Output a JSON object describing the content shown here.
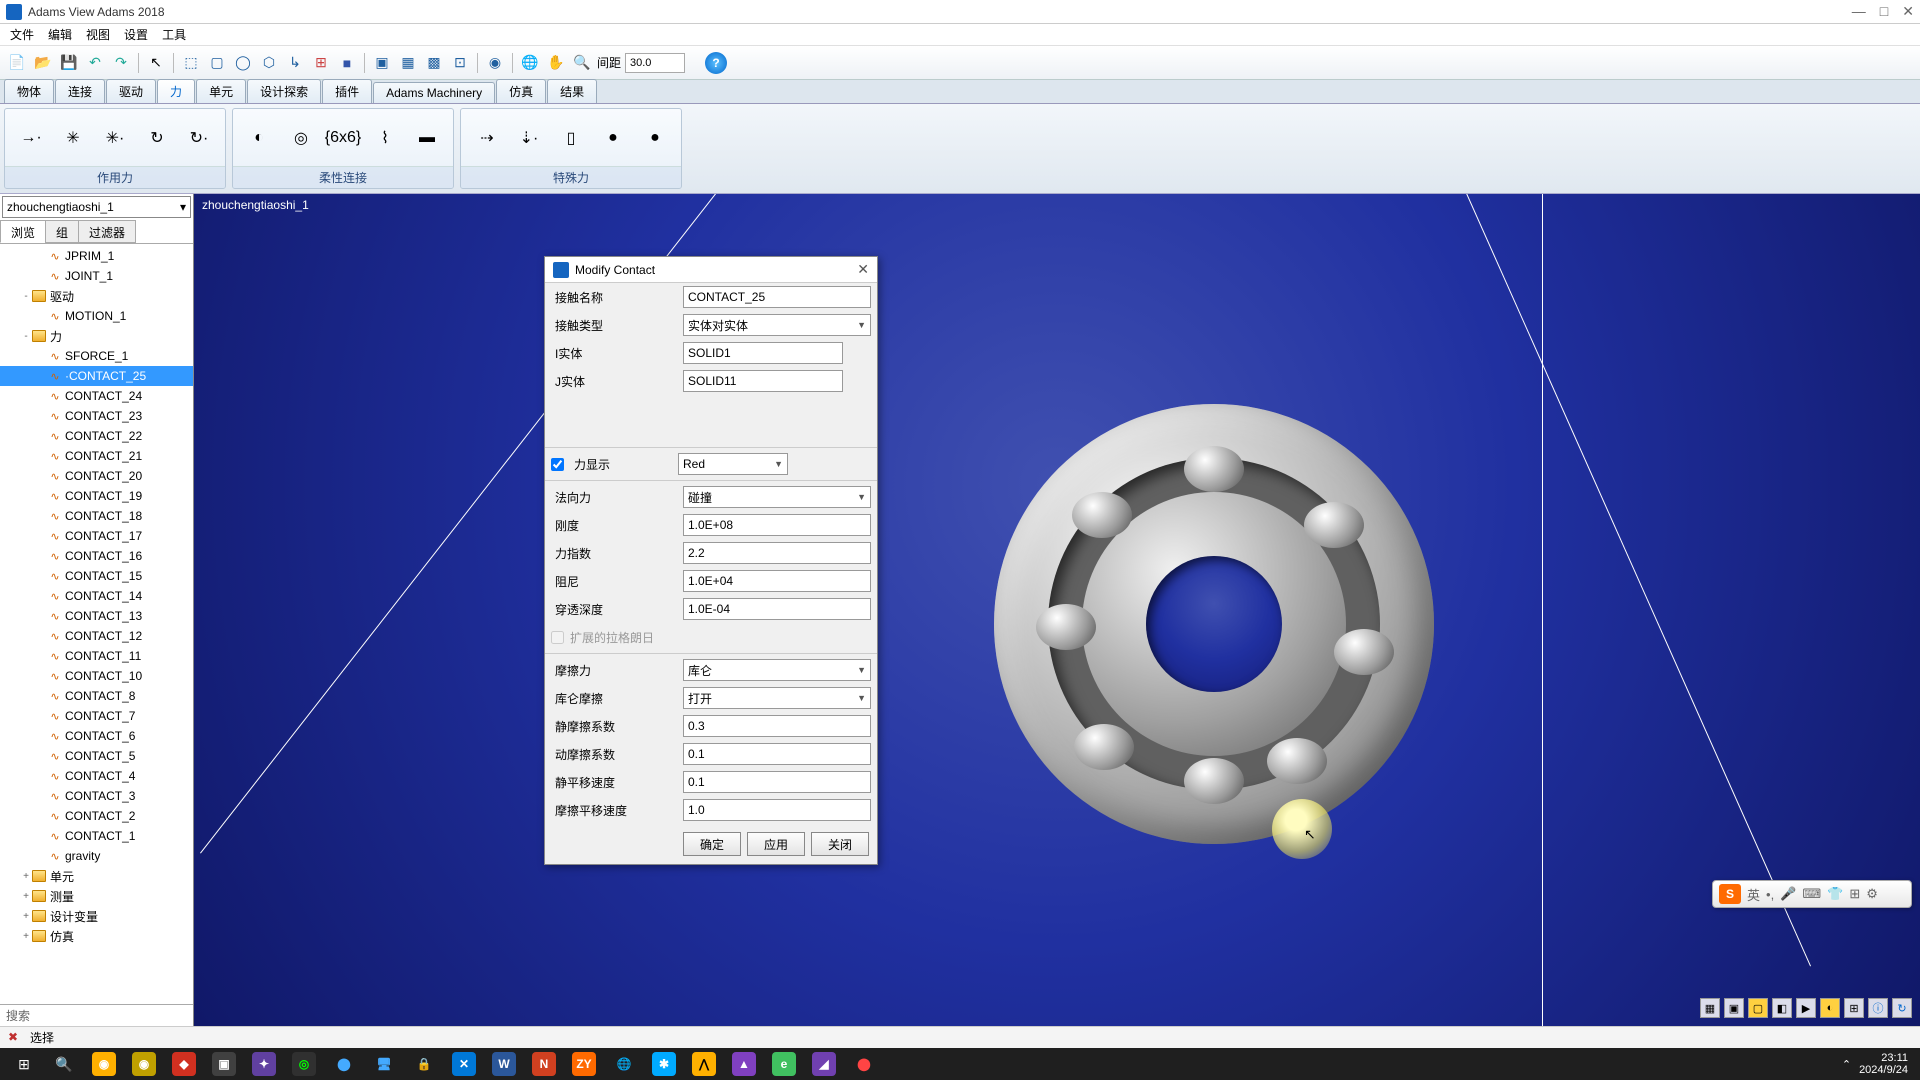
{
  "window": {
    "title": "Adams View Adams 2018",
    "minimize": "—",
    "maximize": "□",
    "close": "✕"
  },
  "menus": [
    "文件",
    "编辑",
    "视图",
    "设置",
    "工具"
  ],
  "toolbar": {
    "gap_label": "间距",
    "gap_value": "30.0"
  },
  "tabs": [
    "物体",
    "连接",
    "驱动",
    "力",
    "单元",
    "设计探索",
    "插件",
    "Adams Machinery",
    "仿真",
    "结果"
  ],
  "active_tab": "力",
  "ribbon": {
    "groups": [
      {
        "label": "作用力",
        "icons": [
          "→·",
          "✳",
          "✳·",
          "↻",
          "↻·"
        ]
      },
      {
        "label": "柔性连接",
        "icons": [
          "◐",
          "◎",
          "{6x6}",
          "⌇",
          "▬"
        ]
      },
      {
        "label": "特殊力",
        "icons": [
          "⇢",
          "⇣·",
          "▯",
          "●",
          "●"
        ]
      }
    ]
  },
  "sidebar": {
    "model": "zhouchengtiaoshi_1",
    "tabs": [
      "浏览",
      "组",
      "过滤器"
    ],
    "tree": [
      {
        "d": 2,
        "icon": "jp",
        "label": "JPRIM_1"
      },
      {
        "d": 2,
        "icon": "jt",
        "label": "JOINT_1"
      },
      {
        "d": 1,
        "exp": "-",
        "folder": true,
        "label": "驱动"
      },
      {
        "d": 2,
        "icon": "mo",
        "label": "MOTION_1"
      },
      {
        "d": 1,
        "exp": "-",
        "folder": true,
        "label": "力"
      },
      {
        "d": 2,
        "icon": "sf",
        "label": "SFORCE_1"
      },
      {
        "d": 2,
        "icon": "ct",
        "label": "·CONTACT_25",
        "selected": true
      },
      {
        "d": 2,
        "icon": "ct",
        "label": "CONTACT_24"
      },
      {
        "d": 2,
        "icon": "ct",
        "label": "CONTACT_23"
      },
      {
        "d": 2,
        "icon": "ct",
        "label": "CONTACT_22"
      },
      {
        "d": 2,
        "icon": "ct",
        "label": "CONTACT_21"
      },
      {
        "d": 2,
        "icon": "ct",
        "label": "CONTACT_20"
      },
      {
        "d": 2,
        "icon": "ct",
        "label": "CONTACT_19"
      },
      {
        "d": 2,
        "icon": "ct",
        "label": "CONTACT_18"
      },
      {
        "d": 2,
        "icon": "ct",
        "label": "CONTACT_17"
      },
      {
        "d": 2,
        "icon": "ct",
        "label": "CONTACT_16"
      },
      {
        "d": 2,
        "icon": "ct",
        "label": "CONTACT_15"
      },
      {
        "d": 2,
        "icon": "ct",
        "label": "CONTACT_14"
      },
      {
        "d": 2,
        "icon": "ct",
        "label": "CONTACT_13"
      },
      {
        "d": 2,
        "icon": "ct",
        "label": "CONTACT_12"
      },
      {
        "d": 2,
        "icon": "ct",
        "label": "CONTACT_11"
      },
      {
        "d": 2,
        "icon": "ct",
        "label": "CONTACT_10"
      },
      {
        "d": 2,
        "icon": "ct",
        "label": "CONTACT_8"
      },
      {
        "d": 2,
        "icon": "ct",
        "label": "CONTACT_7"
      },
      {
        "d": 2,
        "icon": "ct",
        "label": "CONTACT_6"
      },
      {
        "d": 2,
        "icon": "ct",
        "label": "CONTACT_5"
      },
      {
        "d": 2,
        "icon": "ct",
        "label": "CONTACT_4"
      },
      {
        "d": 2,
        "icon": "ct",
        "label": "CONTACT_3"
      },
      {
        "d": 2,
        "icon": "ct",
        "label": "CONTACT_2"
      },
      {
        "d": 2,
        "icon": "ct",
        "label": "CONTACT_1"
      },
      {
        "d": 2,
        "icon": "gv",
        "label": "gravity"
      },
      {
        "d": 1,
        "exp": "+",
        "folder": true,
        "label": "单元"
      },
      {
        "d": 1,
        "exp": "+",
        "folder": true,
        "label": "测量"
      },
      {
        "d": 1,
        "exp": "+",
        "folder": true,
        "label": "设计变量"
      },
      {
        "d": 1,
        "exp": "+",
        "folder": true,
        "label": "仿真"
      }
    ],
    "search": "搜索"
  },
  "viewport": {
    "label": "zhouchengtiaoshi_1"
  },
  "dialog": {
    "title": "Modify Contact",
    "rows": {
      "contact_name_l": "接触名称",
      "contact_name_v": "CONTACT_25",
      "contact_type_l": "接触类型",
      "contact_type_v": "实体对实体",
      "ibody_l": "I实体",
      "ibody_v": "SOLID1",
      "jbody_l": "J实体",
      "jbody_v": "SOLID11",
      "force_disp_l": "力显示",
      "force_disp_v": "Red",
      "normal_l": "法向力",
      "normal_v": "碰撞",
      "stiff_l": "刚度",
      "stiff_v": "1.0E+08",
      "exp_l": "力指数",
      "exp_v": "2.2",
      "damp_l": "阻尼",
      "damp_v": "1.0E+04",
      "pen_l": "穿透深度",
      "pen_v": "1.0E-04",
      "lag_l": "扩展的拉格朗日",
      "fric_l": "摩擦力",
      "fric_v": "库仑",
      "coul_l": "库仑摩擦",
      "coul_v": "打开",
      "mus_l": "静摩擦系数",
      "mus_v": "0.3",
      "mud_l": "动摩擦系数",
      "mud_v": "0.1",
      "vs_l": "静平移速度",
      "vs_v": "0.1",
      "vd_l": "摩擦平移速度",
      "vd_v": "1.0"
    },
    "buttons": {
      "ok": "确定",
      "apply": "应用",
      "close": "关闭"
    }
  },
  "status": {
    "select": "选择"
  },
  "taskbar": {
    "time": "23:11",
    "date": "2024/9/24"
  }
}
